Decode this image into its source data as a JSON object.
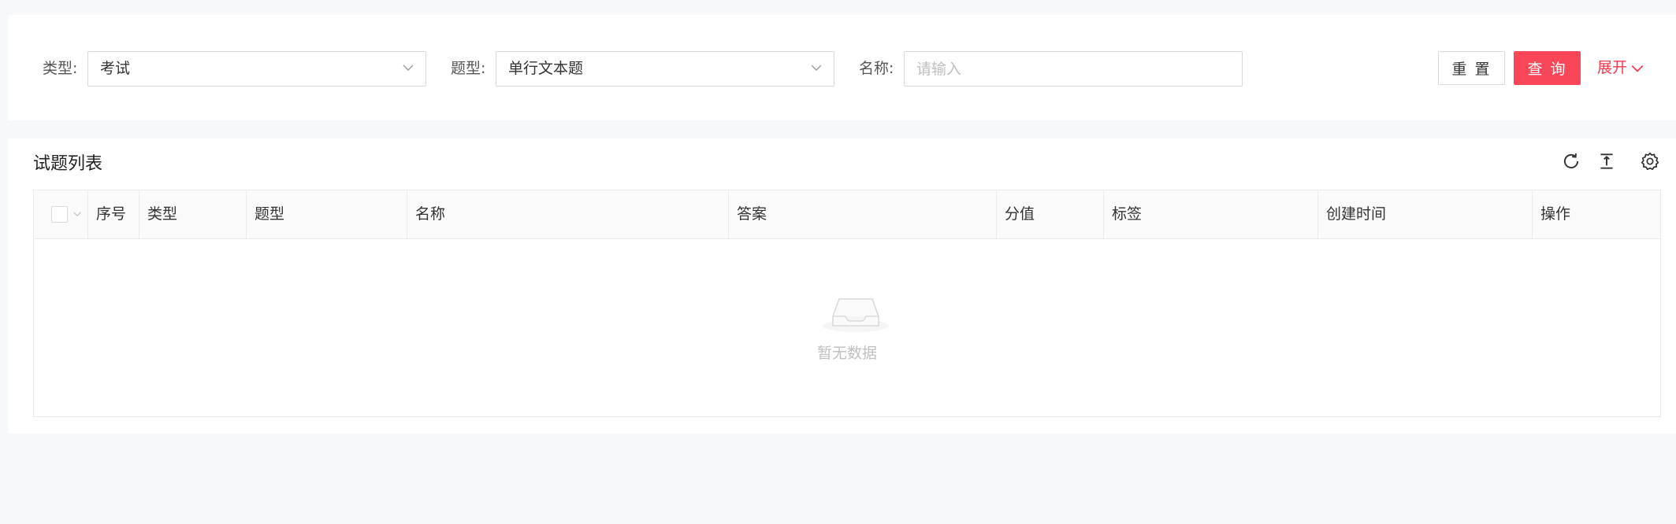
{
  "filters": {
    "type": {
      "label": "类型:",
      "value": "考试"
    },
    "question_type": {
      "label": "题型:",
      "value": "单行文本题"
    },
    "name": {
      "label": "名称:",
      "placeholder": "请输入",
      "value": ""
    }
  },
  "actions": {
    "reset_label": "重 置",
    "query_label": "查 询",
    "expand_label": "展开"
  },
  "list": {
    "title": "试题列表",
    "toolbar_icons": [
      "refresh-icon",
      "column-height-icon",
      "setting-icon"
    ],
    "columns": [
      "序号",
      "类型",
      "题型",
      "名称",
      "答案",
      "分值",
      "标签",
      "创建时间",
      "操作"
    ],
    "rows": [],
    "empty_text": "暂无数据"
  },
  "colors": {
    "primary": "#fa4659",
    "link": "#f5364f",
    "page_bg": "#f7f8fa"
  }
}
